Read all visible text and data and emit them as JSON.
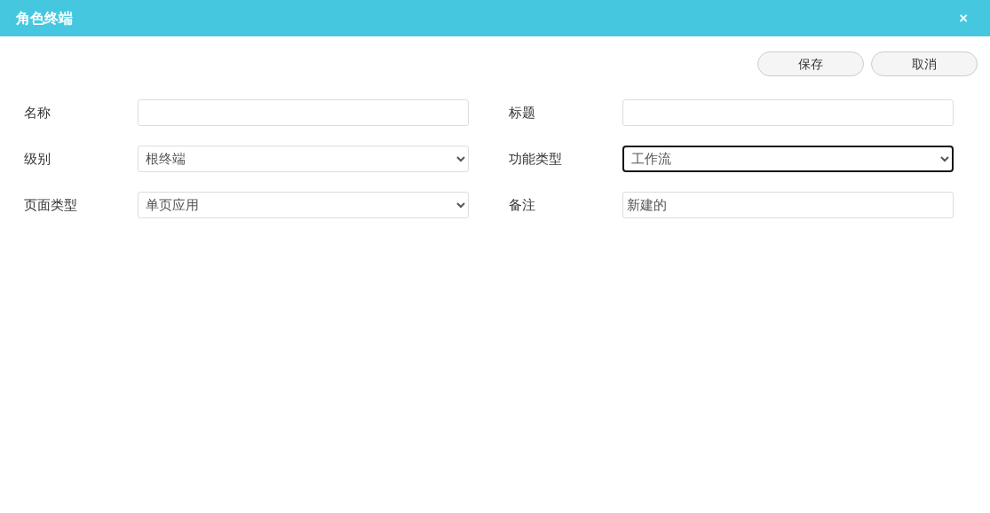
{
  "window": {
    "title": "角色终端",
    "close": "×"
  },
  "buttons": [
    "保存",
    "取消"
  ],
  "fields": [
    {
      "label": "名称",
      "kind": "text",
      "focused": false
    },
    {
      "label": "标题",
      "kind": "text",
      "focused": false
    },
    {
      "label": "级别",
      "kind": "select",
      "value": "根终端",
      "focused": false
    },
    {
      "label": "功能类型",
      "kind": "select",
      "value": "工作流",
      "focused": true
    },
    {
      "label": "页面类型",
      "kind": "select",
      "value": "单页应用",
      "focused": false
    },
    {
      "label": "备注",
      "kind": "text",
      "value": "新建的",
      "focused": false
    }
  ]
}
